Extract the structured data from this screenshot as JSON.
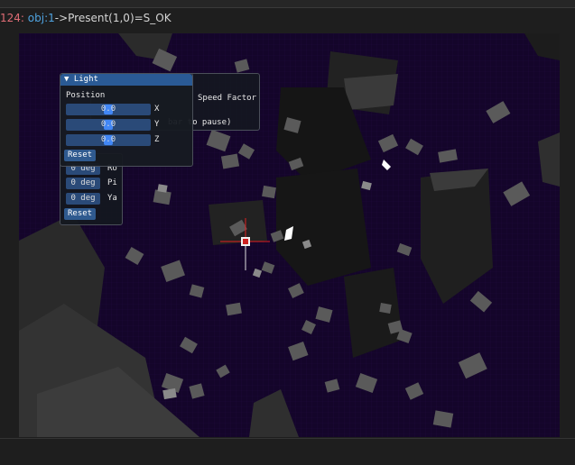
{
  "log": {
    "line_number": "124:",
    "object": "obj:1",
    "message": "->Present(1,0)=S_OK"
  },
  "back_panel": {
    "speed_label": "Speed Factor",
    "hint": "bar to pause)"
  },
  "light_window": {
    "title": "▼ Light",
    "position_label": "Position",
    "x_value": "0.0",
    "y_value": "0.0",
    "z_value": "0.0",
    "x_axis": "X",
    "y_axis": "Y",
    "z_axis": "Z",
    "reset_label": "Reset"
  },
  "rotation_window": {
    "roll_value": "0 deg",
    "pitch_value": "0 deg",
    "yaw_value": "0 deg",
    "roll_label": "Ro",
    "pitch_label": "Pi",
    "yaw_label": "Ya",
    "reset_label": "Reset"
  },
  "colors": {
    "viewport_bg": "#14052a",
    "title_blue": "#2a5a95",
    "slider_grab": "#4287f5",
    "crosshair": "#e02020"
  }
}
